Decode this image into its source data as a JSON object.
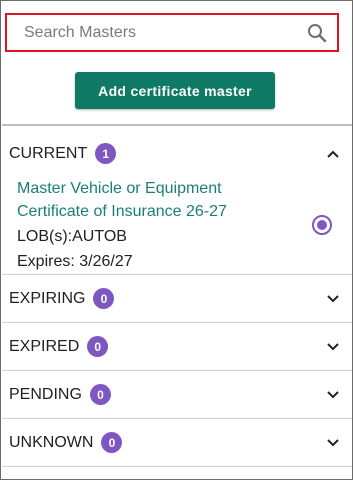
{
  "search": {
    "placeholder": "Search Masters",
    "icon": "search-icon"
  },
  "add_button": {
    "label": "Add certificate master",
    "color": "#0e7a66"
  },
  "accent": {
    "badge": "#7e57c2",
    "link": "#1a7f72",
    "search_border": "#e0141e"
  },
  "sections": [
    {
      "label": "CURRENT",
      "count": "1",
      "expanded": true
    },
    {
      "label": "EXPIRING",
      "count": "0",
      "expanded": false
    },
    {
      "label": "EXPIRED",
      "count": "0",
      "expanded": false
    },
    {
      "label": "PENDING",
      "count": "0",
      "expanded": false
    },
    {
      "label": "UNKNOWN",
      "count": "0",
      "expanded": false
    }
  ],
  "current_items": [
    {
      "title": "Master Vehicle or Equipment Certificate of Insurance 26-27",
      "lob": "LOB(s):AUTOB",
      "expires": "Expires: 3/26/27",
      "selected": true
    }
  ]
}
